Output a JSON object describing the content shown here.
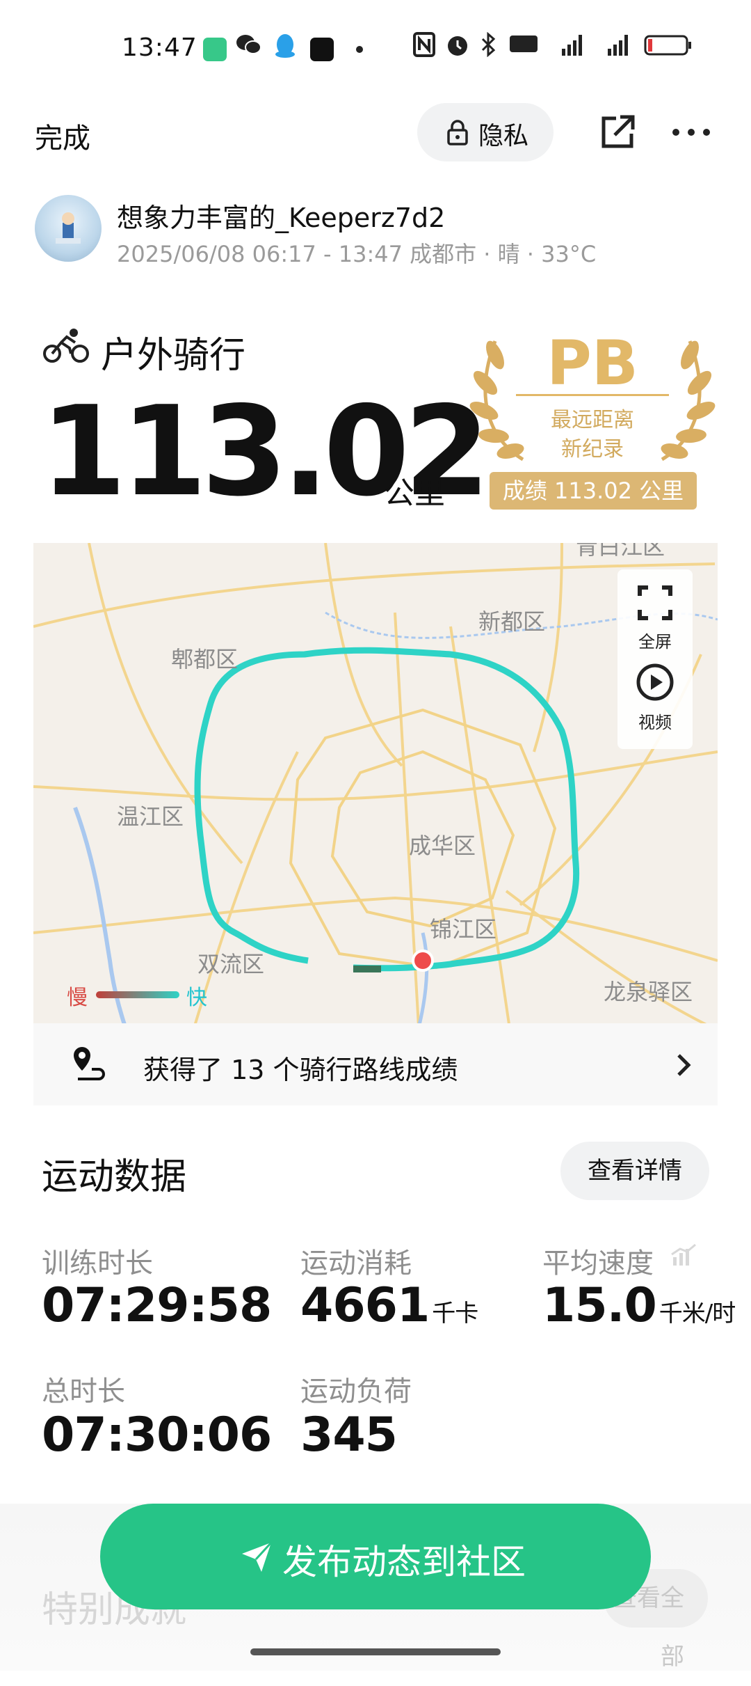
{
  "status_bar": {
    "time": "13:47"
  },
  "header": {
    "done_label": "完成",
    "privacy_label": "隐私"
  },
  "user": {
    "name": "想象力丰富的_Keeperz7d2",
    "meta": "2025/06/08 06:17 - 13:47 成都市 · 晴 · 33°C"
  },
  "activity": {
    "type": "户外骑行",
    "distance": "113.02",
    "unit": "公里"
  },
  "pb_badge": {
    "title": "PB",
    "line1": "最远距离",
    "line2": "新纪录",
    "record": "成绩 113.02 公里"
  },
  "map": {
    "labels": {
      "top": "青白江区",
      "xindu": "新都区",
      "pidu": "郫都区",
      "wenjiang": "温江区",
      "chenghua": "成华区",
      "jinjiang": "锦江区",
      "shuangliu": "双流区",
      "longquanyi": "龙泉驿区"
    },
    "fullscreen_label": "全屏",
    "video_label": "视频",
    "legend_slow": "慢",
    "legend_fast": "快",
    "route_colors": {
      "slow": "#c0403a",
      "fast": "#2ed3c6"
    }
  },
  "route_banner": {
    "text": "获得了 13 个骑行路线成绩"
  },
  "stats": {
    "title": "运动数据",
    "detail_button": "查看详情",
    "items": [
      {
        "label": "训练时长",
        "value": "07:29:58",
        "unit": ""
      },
      {
        "label": "运动消耗",
        "value": "4661",
        "unit": "千卡"
      },
      {
        "label": "平均速度",
        "value": "15.0",
        "unit": "千米/时"
      },
      {
        "label": "总时长",
        "value": "07:30:06",
        "unit": ""
      },
      {
        "label": "运动负荷",
        "value": "345",
        "unit": ""
      }
    ]
  },
  "special": {
    "title": "特别成就",
    "view_all": "查看全部"
  },
  "publish": {
    "label": "发布动态到社区",
    "color": "#26c487"
  }
}
